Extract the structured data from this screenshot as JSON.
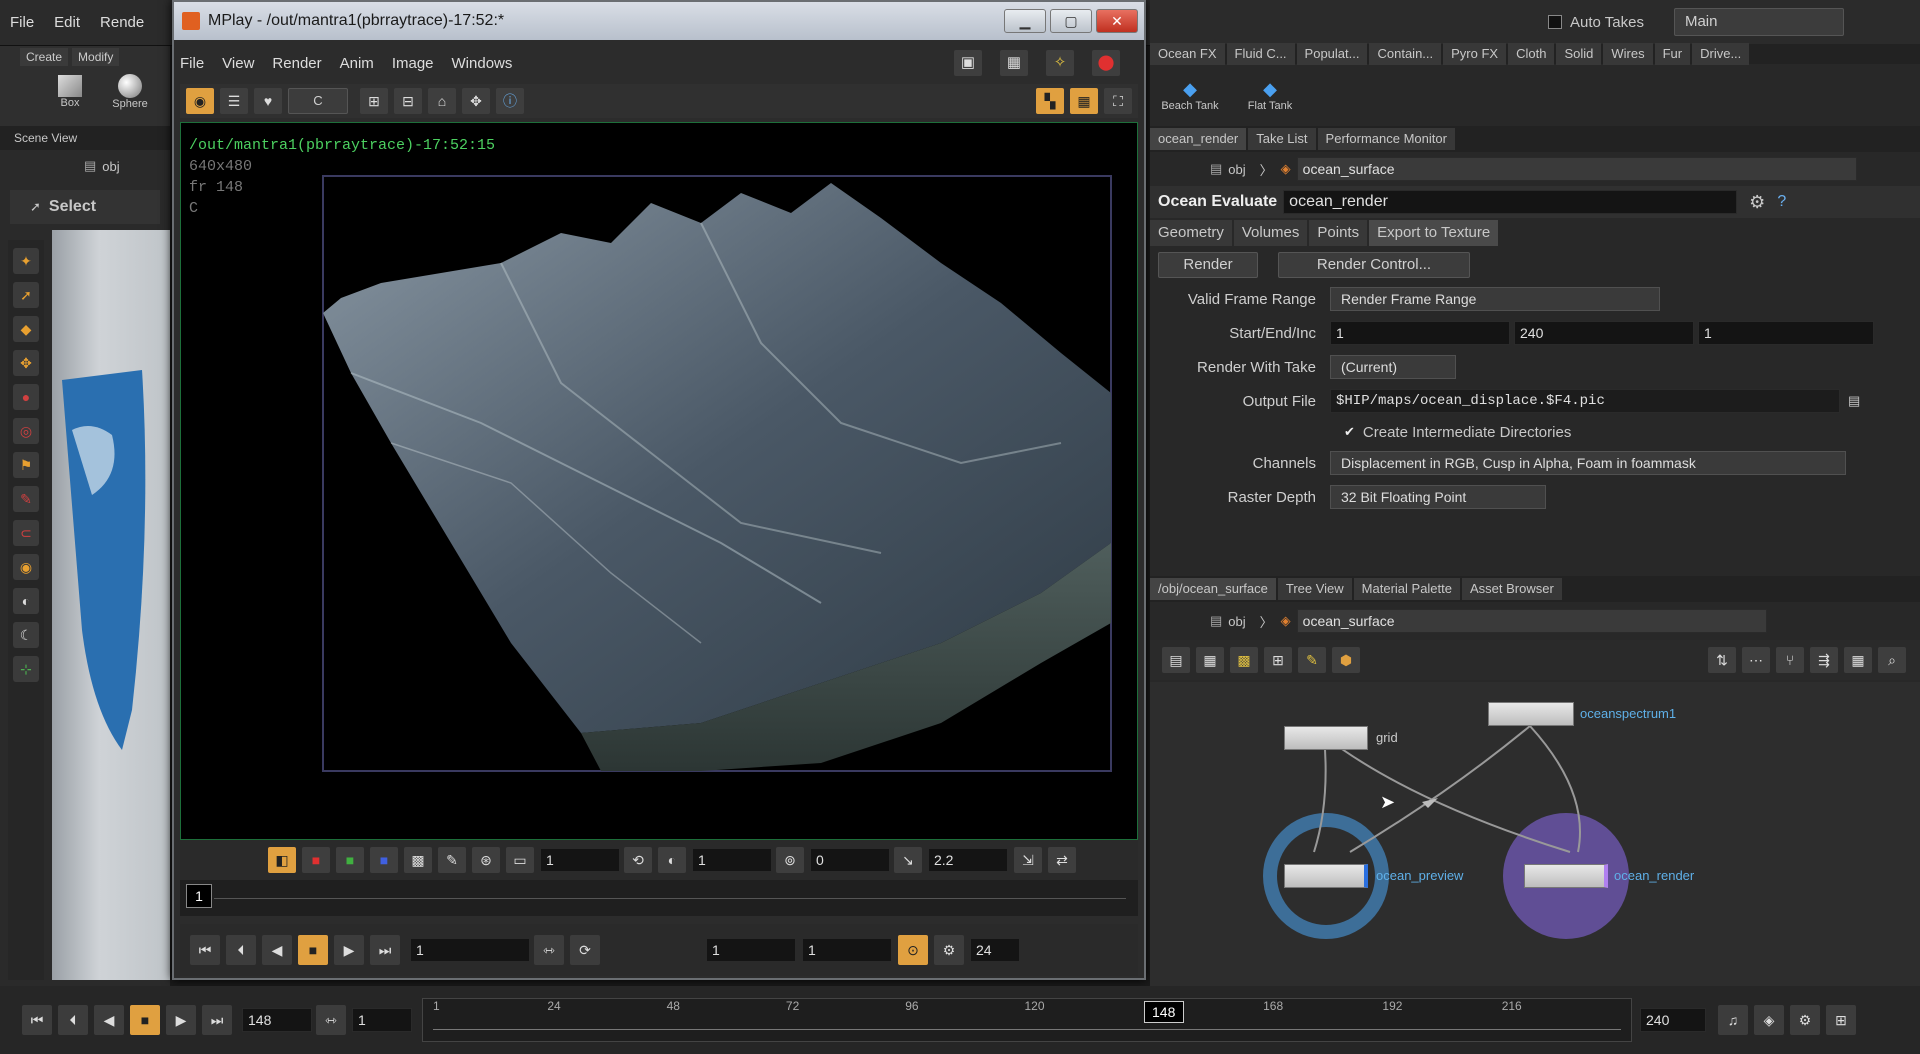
{
  "menubar": {
    "items": [
      "File",
      "Edit",
      "Rende"
    ],
    "auto_takes": "Auto Takes",
    "desktop": "Main"
  },
  "shelf": {
    "tabs": [
      "Create",
      "Modify"
    ],
    "tools": [
      "Box",
      "Sphere"
    ]
  },
  "left": {
    "scene_view": "Scene View",
    "path": "obj",
    "select_tool": "Select"
  },
  "shelf_right": {
    "tabs": [
      "Ocean FX",
      "Fluid C...",
      "Populat...",
      "Contain...",
      "Pyro FX",
      "Cloth",
      "Solid",
      "Wires",
      "Fur",
      "Drive..."
    ],
    "tools": [
      "Beach Tank",
      "Flat Tank"
    ]
  },
  "mplay": {
    "title": "MPlay - /out/mantra1(pbrraytrace)-17:52:*",
    "menu": [
      "File",
      "View",
      "Render",
      "Anim",
      "Image",
      "Windows"
    ],
    "channel": "C",
    "info": [
      "/out/mantra1(pbrraytrace)-17:52:15",
      "640x480",
      "fr 148",
      "C"
    ],
    "ctrl": {
      "field1": "1",
      "field2": "1",
      "field3": "0",
      "gamma": "2.2"
    },
    "frame_marker": "1",
    "play": {
      "frame": "1",
      "start": "1",
      "end": "1",
      "fps": "24"
    }
  },
  "params": {
    "tabs": [
      "ocean_render",
      "Take List",
      "Performance Monitor"
    ],
    "path_root": "obj",
    "path_node": "ocean_surface",
    "node_type": "Ocean Evaluate",
    "node_name": "ocean_render",
    "subtabs": [
      "Geometry",
      "Volumes",
      "Points",
      "Export to Texture"
    ],
    "render_btn": "Render",
    "render_ctrl_btn": "Render Control...",
    "rows": {
      "valid_frame_range": {
        "label": "Valid Frame Range",
        "value": "Render Frame Range"
      },
      "start_end_inc": {
        "label": "Start/End/Inc",
        "start": "1",
        "end": "240",
        "inc": "1"
      },
      "render_with_take": {
        "label": "Render With Take",
        "value": "(Current)"
      },
      "output_file": {
        "label": "Output File",
        "value": "$HIP/maps/ocean_displace.$F4.pic"
      },
      "create_dirs": {
        "label": "Create Intermediate Directories"
      },
      "channels": {
        "label": "Channels",
        "value": "Displacement in RGB, Cusp in Alpha, Foam in foammask"
      },
      "raster_depth": {
        "label": "Raster Depth",
        "value": "32 Bit Floating Point"
      }
    }
  },
  "network": {
    "tabs": [
      "/obj/ocean_surface",
      "Tree View",
      "Material Palette",
      "Asset Browser"
    ],
    "path_root": "obj",
    "path_node": "ocean_surface",
    "nodes": {
      "grid": "grid",
      "spectrum": "oceanspectrum1",
      "preview": "ocean_preview",
      "render": "ocean_render"
    }
  },
  "timeline": {
    "current": "148",
    "start": "1",
    "end": "240",
    "step": "1",
    "ticks": [
      "1",
      "24",
      "48",
      "72",
      "96",
      "120",
      "168",
      "192",
      "216"
    ]
  },
  "colors": {
    "accent": "#e0a040",
    "preview_ring": "#3d6e98",
    "render_disk": "#6a55a8"
  }
}
